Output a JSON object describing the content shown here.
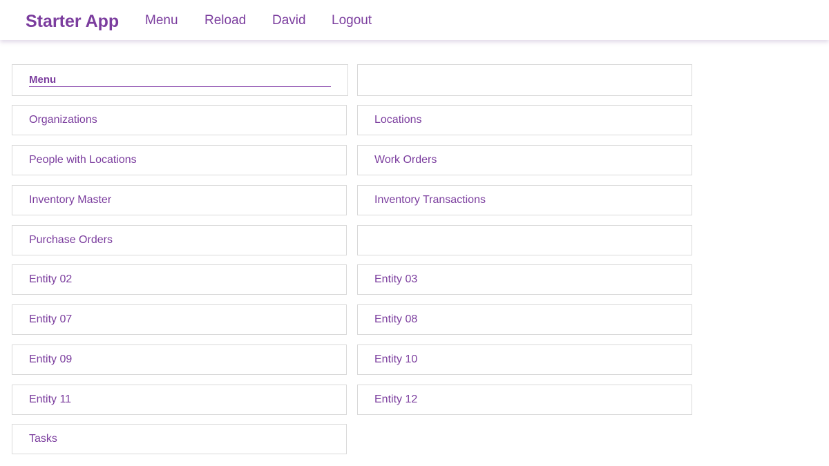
{
  "header": {
    "brand": "Starter App",
    "nav": {
      "menu": "Menu",
      "reload": "Reload",
      "user": "David",
      "logout": "Logout"
    }
  },
  "menu": {
    "heading": "Menu",
    "left": [
      "Organizations",
      "People with Locations",
      "Inventory Master",
      "Purchase Orders",
      "Entity 02",
      "Entity 07",
      "Entity 09",
      "Entity 11",
      "Tasks"
    ],
    "right": [
      "Locations",
      "Work Orders",
      "Inventory Transactions",
      "",
      "Entity 03",
      "Entity 08",
      "Entity 10",
      "Entity 12"
    ]
  },
  "colors": {
    "accent": "#7b3d9e",
    "border": "#d9d9d9"
  }
}
